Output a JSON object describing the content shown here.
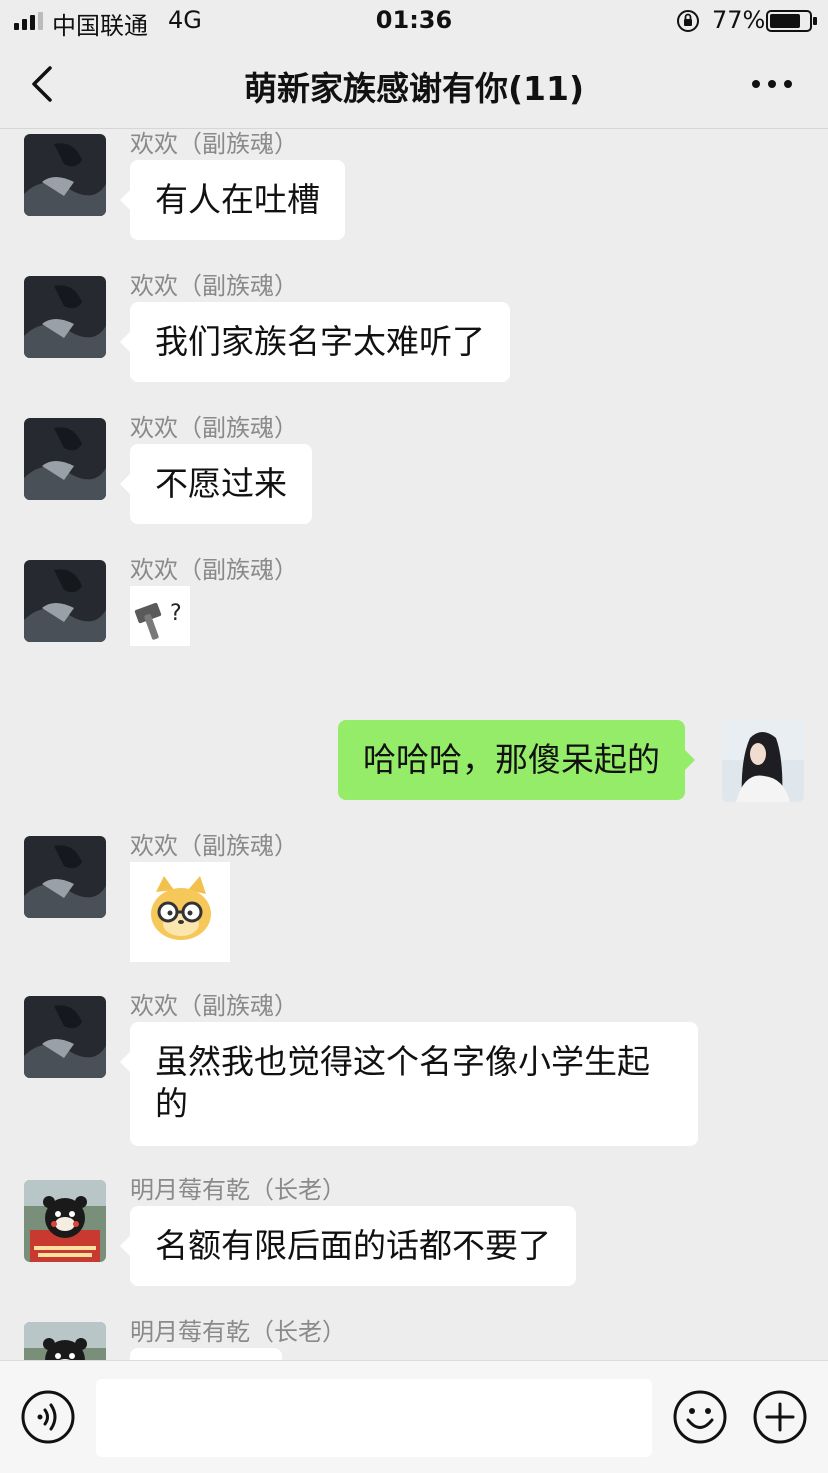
{
  "status_bar": {
    "carrier": "中国联通",
    "network": "4G",
    "time": "01:36",
    "battery": "77%"
  },
  "nav": {
    "title": "萌新家族感谢有你(11)"
  },
  "messages": [
    {
      "sender": "欢欢（副族魂）",
      "text": "有人在吐槽"
    },
    {
      "sender": "欢欢（副族魂）",
      "text": "我们家族名字太难听了"
    },
    {
      "sender": "欢欢（副族魂）",
      "text": "不愿过来"
    },
    {
      "sender": "欢欢（副族魂）",
      "sticker": "hammer-question-sticker"
    },
    {
      "self": true,
      "text": "哈哈哈，那傻呆起的"
    },
    {
      "sender": "欢欢（副族魂）",
      "sticker": "doge-glasses-sticker"
    },
    {
      "sender": "欢欢（副族魂）",
      "text_lines": [
        "虽然我也觉得这个名字像小学生起",
        "的"
      ]
    },
    {
      "sender": "明月莓有乾（长老）",
      "text": "名额有限后面的话都不要了"
    },
    {
      "sender": "明月莓有乾（长老）"
    }
  ],
  "input": {
    "placeholder": ""
  },
  "icons": {
    "signal": "signal-icon",
    "lock": "rotation-lock-icon",
    "battery": "battery-icon",
    "back": "back-arrow-icon",
    "more": "more-icon",
    "voice": "voice-icon",
    "emoji": "emoji-icon",
    "plus": "plus-icon"
  },
  "colors": {
    "background": "#ededed",
    "self_bubble": "#95ec69",
    "other_bubble": "#ffffff",
    "sender_name": "#8a8a8a"
  }
}
